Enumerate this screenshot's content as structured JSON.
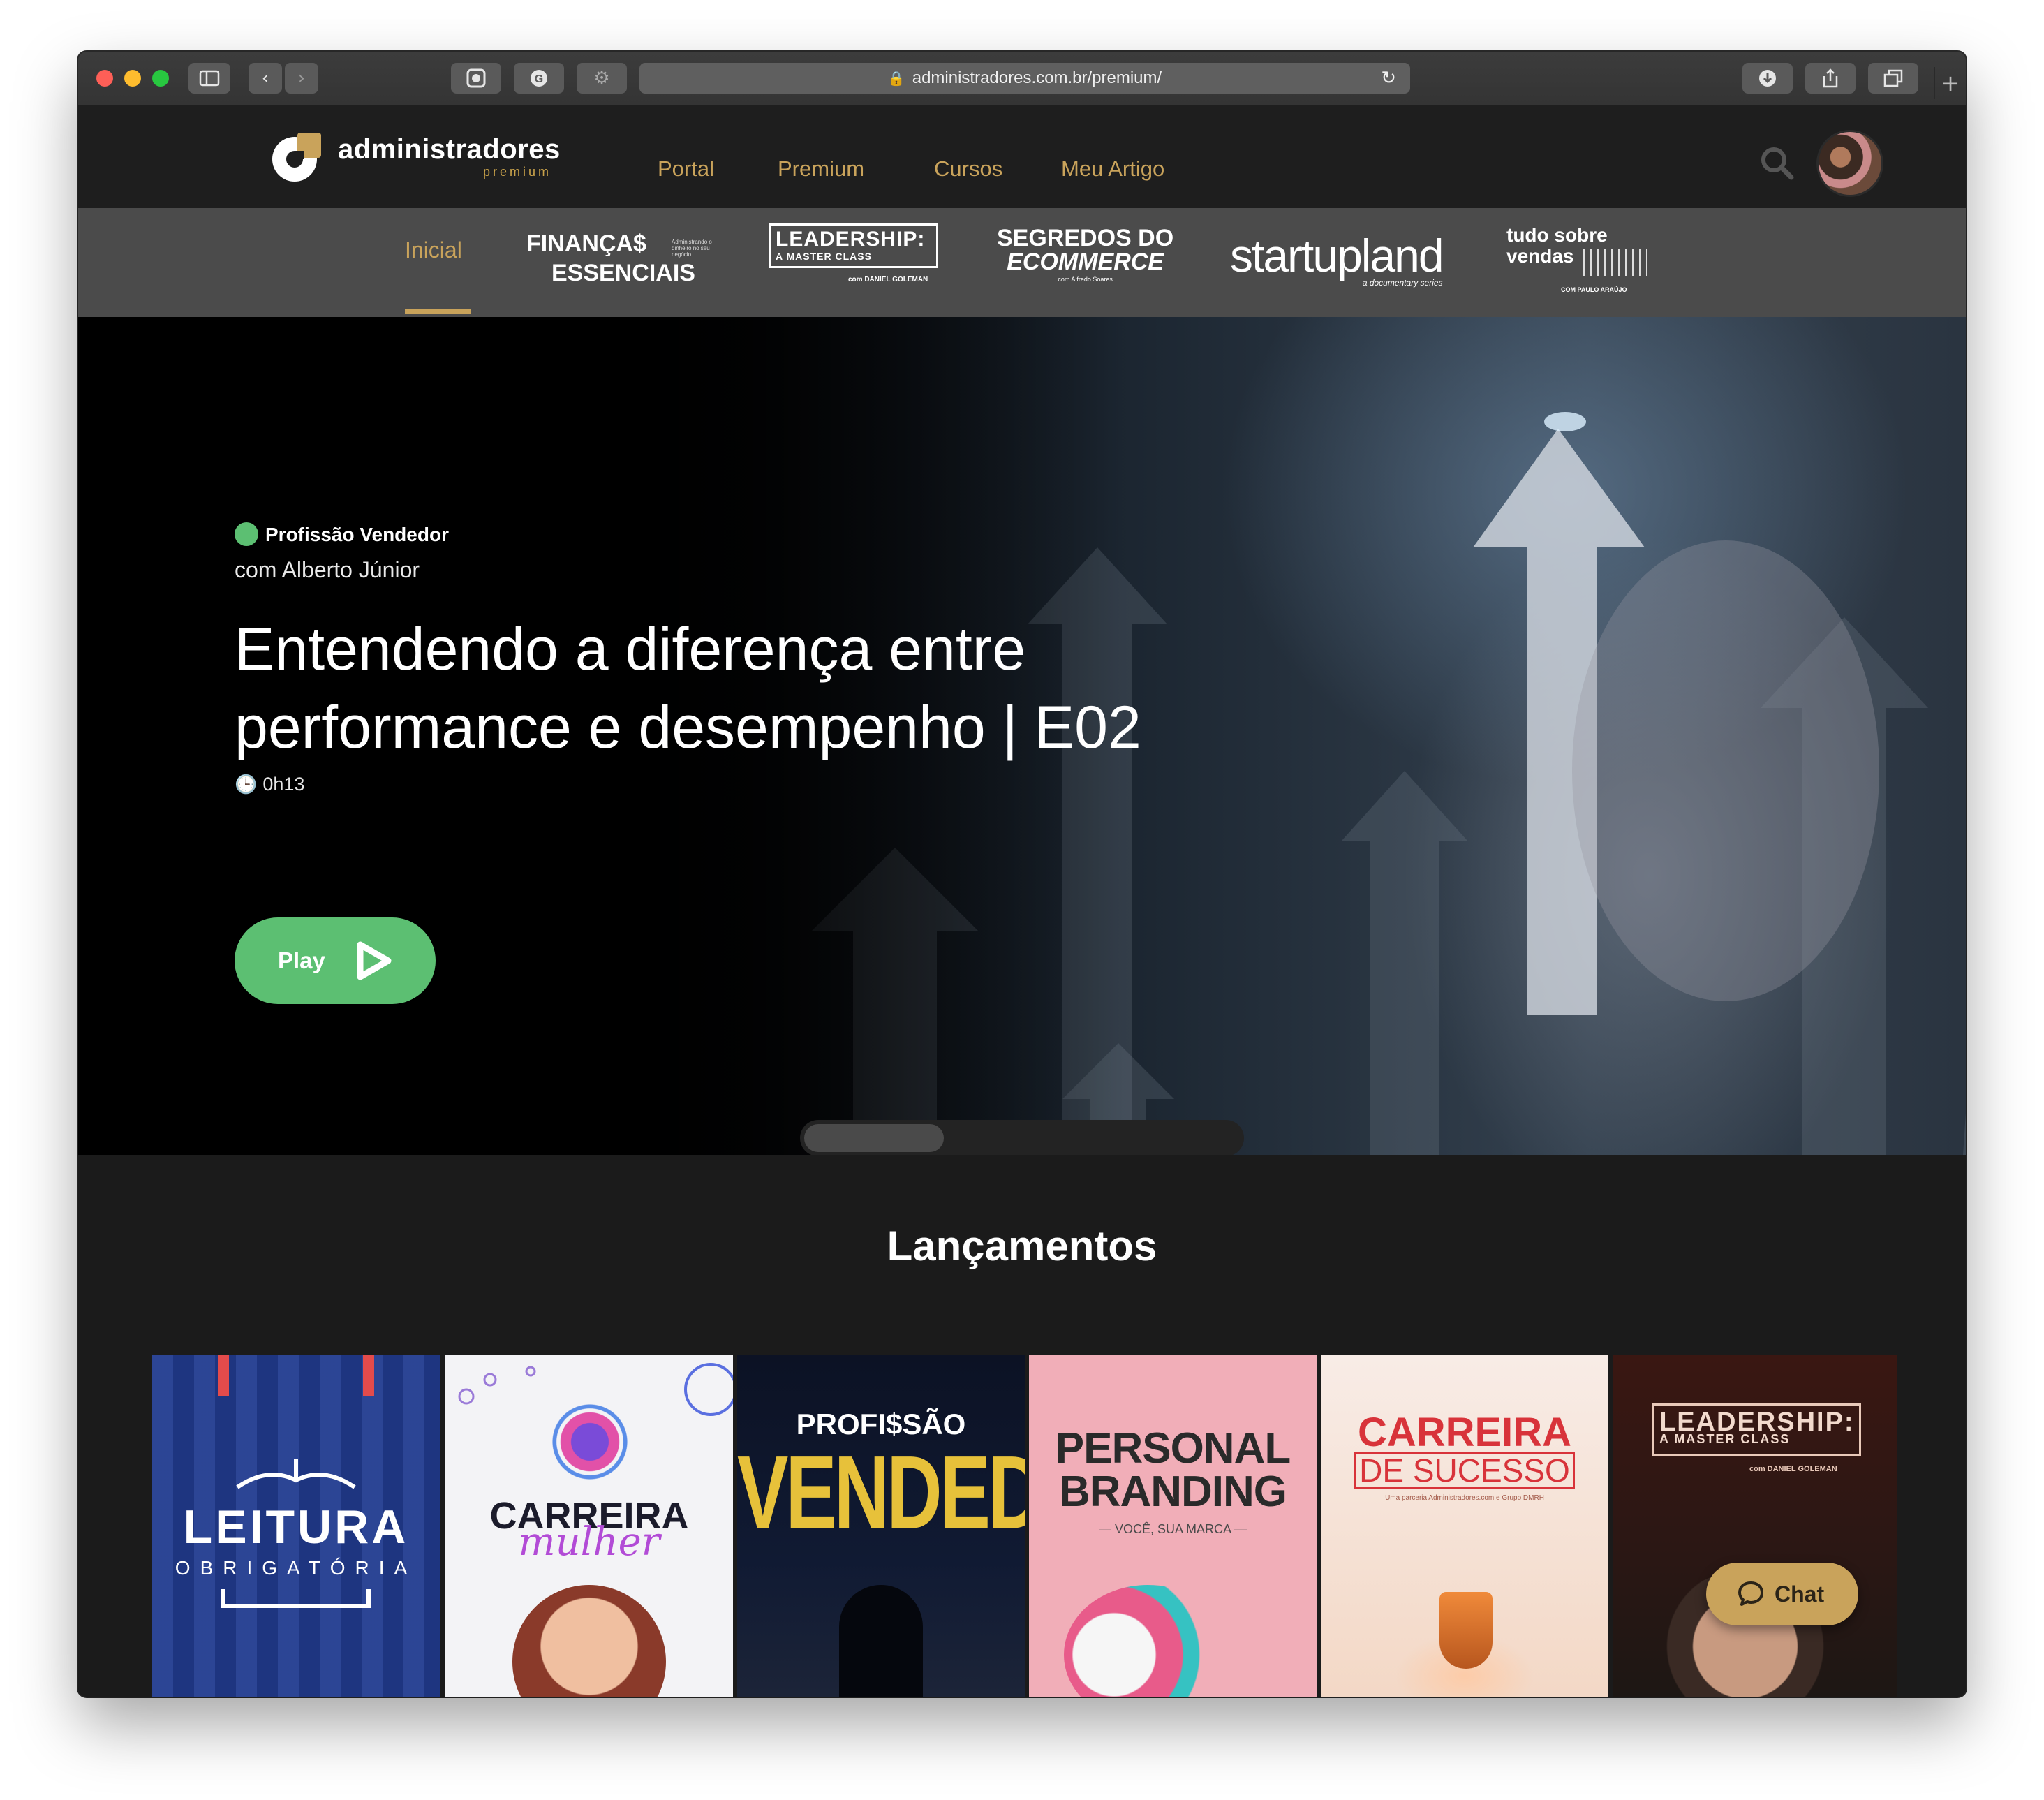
{
  "browser": {
    "url": "administradores.com.br/premium/",
    "traffic_lights": [
      "#fe5f57",
      "#febc2e",
      "#28c840"
    ]
  },
  "header": {
    "logo_text": "administradores",
    "logo_sub": "premium",
    "nav": [
      "Portal",
      "Premium",
      "Cursos",
      "Meu Artigo"
    ],
    "accent_color": "#c9a35b"
  },
  "categories": {
    "inicial": "Inicial",
    "financas": {
      "line1": "FINANÇA$",
      "line2": "ESSENCIAIS",
      "tagline": "Administrando o dinheiro no seu negócio"
    },
    "leadership": {
      "title": "LEADERSHIP:",
      "subtitle": "A MASTER CLASS",
      "author": "com DANIEL GOLEMAN"
    },
    "segredos": {
      "line1": "SEGREDOS DO",
      "line2": "ECOMMERCE",
      "author": "com Alfredo Soares"
    },
    "startupland": {
      "title": "startupland",
      "subtitle": "a documentary series"
    },
    "tudo": {
      "line1": "tudo sobre",
      "line2": "vendas",
      "author": "COM PAULO ARAÚJO"
    }
  },
  "hero": {
    "series": "Profissão Vendedor",
    "author": "com Alberto Júnior",
    "title": "Entendendo a diferença entre performance e desempenho | E02",
    "duration": "0h13",
    "play_label": "Play",
    "badge_color": "#5cbf72"
  },
  "section": {
    "title": "Lançamentos",
    "cards": [
      {
        "title": "LEITURA",
        "subtitle": "OBRIGATÓRIA"
      },
      {
        "title": "CARREIRA",
        "subtitle": "mulher"
      },
      {
        "title": "PROFI$SÃO",
        "subtitle": "VENDEDOR"
      },
      {
        "title": "PERSONAL BRANDING",
        "subtitle": "— VOCÊ, SUA MARCA —"
      },
      {
        "title": "CARREIRA",
        "subtitle": "DE SUCESSO",
        "note": "Uma parceria Administradores.com e Grupo DMRH"
      },
      {
        "title": "LEADERSHIP:",
        "subtitle": "A MASTER CLASS",
        "note": "com DANIEL GOLEMAN"
      }
    ]
  },
  "chat": {
    "label": "Chat"
  }
}
